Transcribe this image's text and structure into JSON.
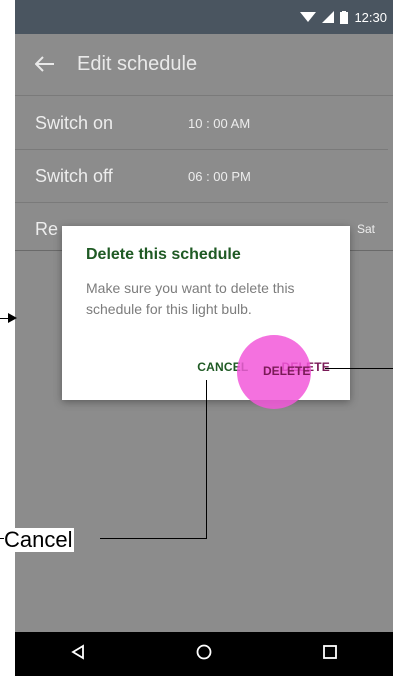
{
  "status_bar": {
    "time": "12:30",
    "icons": [
      "wifi-icon",
      "signal-icon",
      "battery-icon"
    ]
  },
  "app_bar": {
    "back_icon": "arrow-left-icon",
    "title": "Edit schedule"
  },
  "rows": {
    "switch_on": {
      "label": "Switch on",
      "value": "10 : 00 AM"
    },
    "switch_off": {
      "label": "Switch off",
      "value": "06 : 00  PM"
    },
    "repeat": {
      "label_partial": "Re",
      "tail": "Sat"
    }
  },
  "dialog": {
    "title": "Delete this schedule",
    "body": "Make sure you want to delete this schedule for this light bulb.",
    "cancel_label": "CANCEL",
    "delete_label": "DELETE"
  },
  "annotation": {
    "label": "Cancel"
  },
  "nav_bar": {
    "icons": [
      "back-triangle-icon",
      "home-circle-icon",
      "recents-square-icon"
    ]
  },
  "colors": {
    "dialog_title": "#1f5a24",
    "delete": "#7a1a57",
    "touch_highlight": "#f258d9",
    "scrim": "#8c8c8c",
    "status_bar": "#4a5560"
  }
}
